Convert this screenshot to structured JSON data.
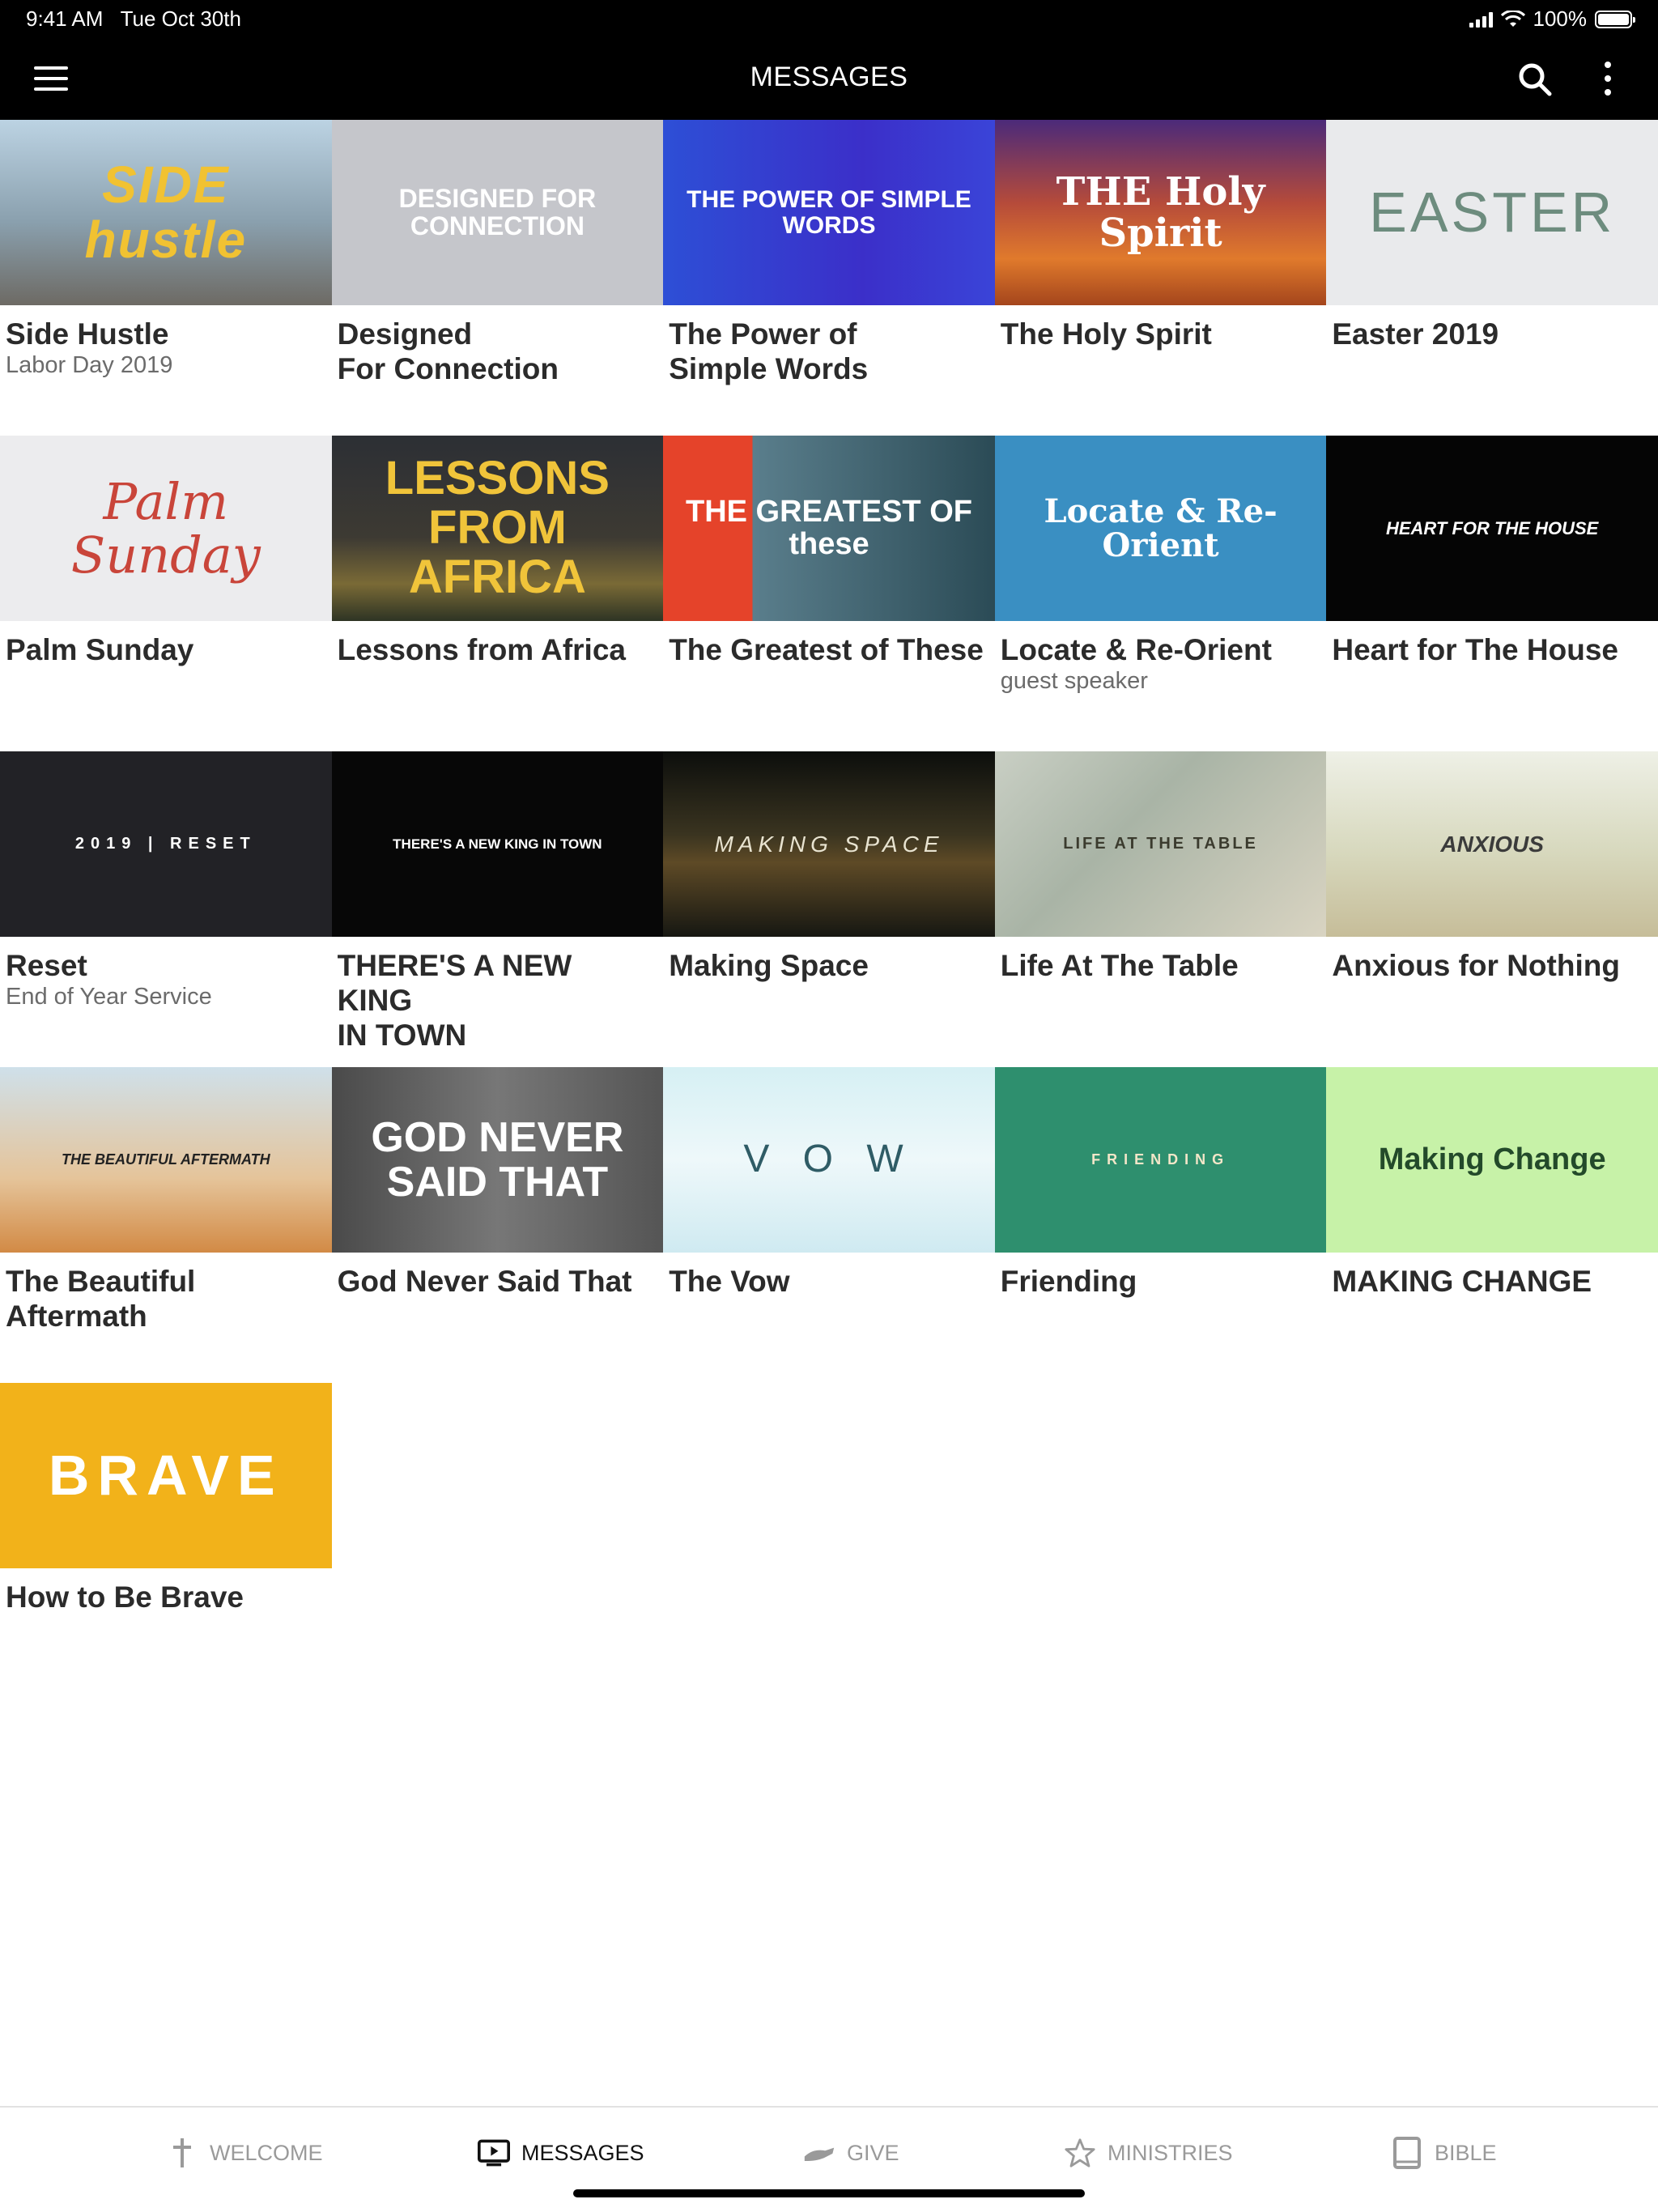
{
  "status_bar": {
    "time": "9:41 AM",
    "date": "Tue Oct 30th",
    "battery": "100%"
  },
  "nav": {
    "title": "MESSAGES"
  },
  "items": [
    {
      "title": "Side Hustle",
      "subtitle": "Labor Day 2019",
      "thumb_text": "SIDE hustle",
      "thumb_class": "t-side"
    },
    {
      "title": "Designed\nFor Connection",
      "subtitle": "",
      "thumb_text": "DESIGNED FOR CONNECTION",
      "thumb_class": "t-designed"
    },
    {
      "title": "The Power of\nSimple Words",
      "subtitle": "",
      "thumb_text": "THE POWER OF SIMPLE WORDS",
      "thumb_class": "t-power"
    },
    {
      "title": "The Holy Spirit",
      "subtitle": "",
      "thumb_text": "THE Holy Spirit",
      "thumb_class": "t-holy"
    },
    {
      "title": "Easter 2019",
      "subtitle": "",
      "thumb_text": "EASTER",
      "thumb_class": "t-easter"
    },
    {
      "title": "Palm Sunday",
      "subtitle": "",
      "thumb_text": "Palm Sunday",
      "thumb_class": "t-palm"
    },
    {
      "title": "Lessons from Africa",
      "subtitle": "",
      "thumb_text": "LESSONS FROM AFRICA",
      "thumb_class": "t-africa"
    },
    {
      "title": "The Greatest of These",
      "subtitle": "",
      "thumb_text": "THE GREATEST OF these",
      "thumb_class": "t-greatest"
    },
    {
      "title": "Locate & Re-Orient",
      "subtitle": "guest speaker",
      "thumb_text": "Locate & Re-Orient",
      "thumb_class": "t-locate"
    },
    {
      "title": "Heart for The House",
      "subtitle": "",
      "thumb_text": "HEART FOR THE HOUSE",
      "thumb_class": "t-heart"
    },
    {
      "title": "Reset",
      "subtitle": "End of Year Service",
      "thumb_text": "2019 | RESET",
      "thumb_class": "t-reset"
    },
    {
      "title": "THERE'S A NEW KING\nIN TOWN",
      "subtitle": "",
      "thumb_text": "THERE'S A NEW KING IN TOWN",
      "thumb_class": "t-king"
    },
    {
      "title": "Making Space",
      "subtitle": "",
      "thumb_text": "MAKING SPACE",
      "thumb_class": "t-making"
    },
    {
      "title": "Life At The Table",
      "subtitle": "",
      "thumb_text": "LIFE AT THE TABLE",
      "thumb_class": "t-life"
    },
    {
      "title": "Anxious for Nothing",
      "subtitle": "",
      "thumb_text": "ANXIOUS",
      "thumb_class": "t-anxious"
    },
    {
      "title": "The Beautiful\nAftermath",
      "subtitle": "",
      "thumb_text": "THE BEAUTIFUL AFTERMATH",
      "thumb_class": "t-beautiful"
    },
    {
      "title": "God Never Said That",
      "subtitle": "",
      "thumb_text": "GOD NEVER SAID THAT",
      "thumb_class": "t-god"
    },
    {
      "title": "The Vow",
      "subtitle": "",
      "thumb_text": "V O W",
      "thumb_class": "t-vow"
    },
    {
      "title": "Friending",
      "subtitle": "",
      "thumb_text": "FRIENDING",
      "thumb_class": "t-friending"
    },
    {
      "title": "MAKING CHANGE",
      "subtitle": "",
      "thumb_text": "Making Change",
      "thumb_class": "t-change"
    },
    {
      "title": "How to Be Brave",
      "subtitle": "",
      "thumb_text": "BRAVE",
      "thumb_class": "t-brave"
    }
  ],
  "tabs": [
    {
      "label": "WELCOME",
      "icon": "cross-icon",
      "active": false
    },
    {
      "label": "MESSAGES",
      "icon": "tv-play-icon",
      "active": true
    },
    {
      "label": "GIVE",
      "icon": "hand-give-icon",
      "active": false
    },
    {
      "label": "MINISTRIES",
      "icon": "star-icon",
      "active": false
    },
    {
      "label": "BIBLE",
      "icon": "book-icon",
      "active": false
    }
  ],
  "colors": {
    "bar_background": "#000000",
    "title_text": "#2b2b2b",
    "subtitle_text": "#6b6b6b",
    "tab_inactive": "#9a9a9a",
    "tab_active": "#111111"
  }
}
